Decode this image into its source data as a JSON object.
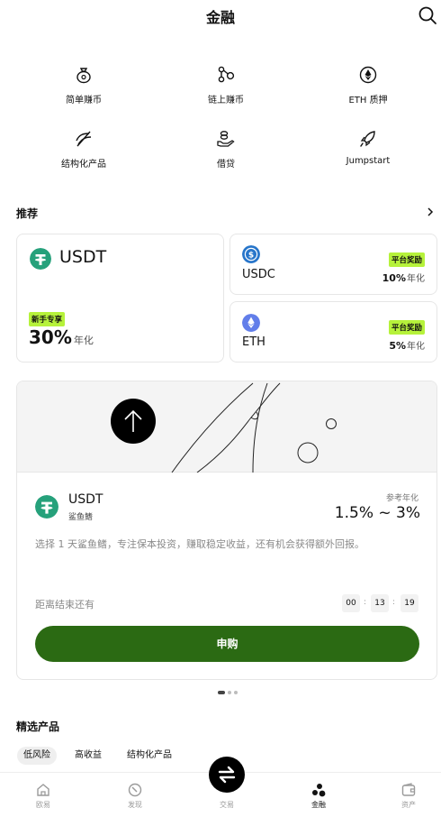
{
  "header": {
    "title": "金融",
    "search_icon": "search-icon"
  },
  "features": [
    {
      "label": "简单赚币",
      "icon": "money-bag-icon"
    },
    {
      "label": "链上赚币",
      "icon": "chain-nodes-icon"
    },
    {
      "label": "ETH 质押",
      "icon": "ethereum-icon"
    },
    {
      "label": "结构化产品",
      "icon": "structured-icon"
    },
    {
      "label": "借贷",
      "icon": "hand-coin-icon"
    },
    {
      "label": "Jumpstart",
      "icon": "rocket-icon"
    }
  ],
  "recommend": {
    "title": "推荐",
    "cards": [
      {
        "coin": "USDT",
        "badge": "新手专享",
        "rate": "30%",
        "rate_unit": "年化",
        "color": "#26a17b"
      },
      {
        "coin": "USDC",
        "badge": "平台奖励",
        "rate": "10%",
        "rate_unit": "年化",
        "color": "#2775ca"
      },
      {
        "coin": "ETH",
        "badge": "平台奖励",
        "rate": "5%",
        "rate_unit": "年化",
        "color": "#627eea"
      }
    ]
  },
  "featured": {
    "coin": "USDT",
    "subtitle": "鲨鱼鳍",
    "ref_label": "参考年化",
    "ref_value": "1.5% ~ 3%",
    "description": "选择 1 天鲨鱼鳍，专注保本投资，赚取稳定收益，还有机会获得额外回报。",
    "countdown_label": "距离结束还有",
    "countdown": [
      "00",
      "13",
      "19"
    ],
    "countdown_sep": ":",
    "button_label": "申购",
    "button_color": "#2b6a13"
  },
  "carousel": {
    "count": 3,
    "active": 0
  },
  "selected": {
    "title": "精选产品",
    "tabs": [
      {
        "label": "低风险",
        "selected": true
      },
      {
        "label": "高收益",
        "selected": false
      },
      {
        "label": "结构化产品",
        "selected": false
      }
    ]
  },
  "bottom_nav": [
    {
      "label": "欧易",
      "icon": "home-icon",
      "active": false
    },
    {
      "label": "发现",
      "icon": "discover-icon",
      "active": false
    },
    {
      "label": "交易",
      "icon": "swap-icon",
      "active": false
    },
    {
      "label": "金融",
      "icon": "finance-icon",
      "active": true
    },
    {
      "label": "资产",
      "icon": "wallet-icon",
      "active": false
    }
  ],
  "colors": {
    "accent_badge": "#b6f23b",
    "primary": "#2b6a13",
    "text": "#121212"
  }
}
